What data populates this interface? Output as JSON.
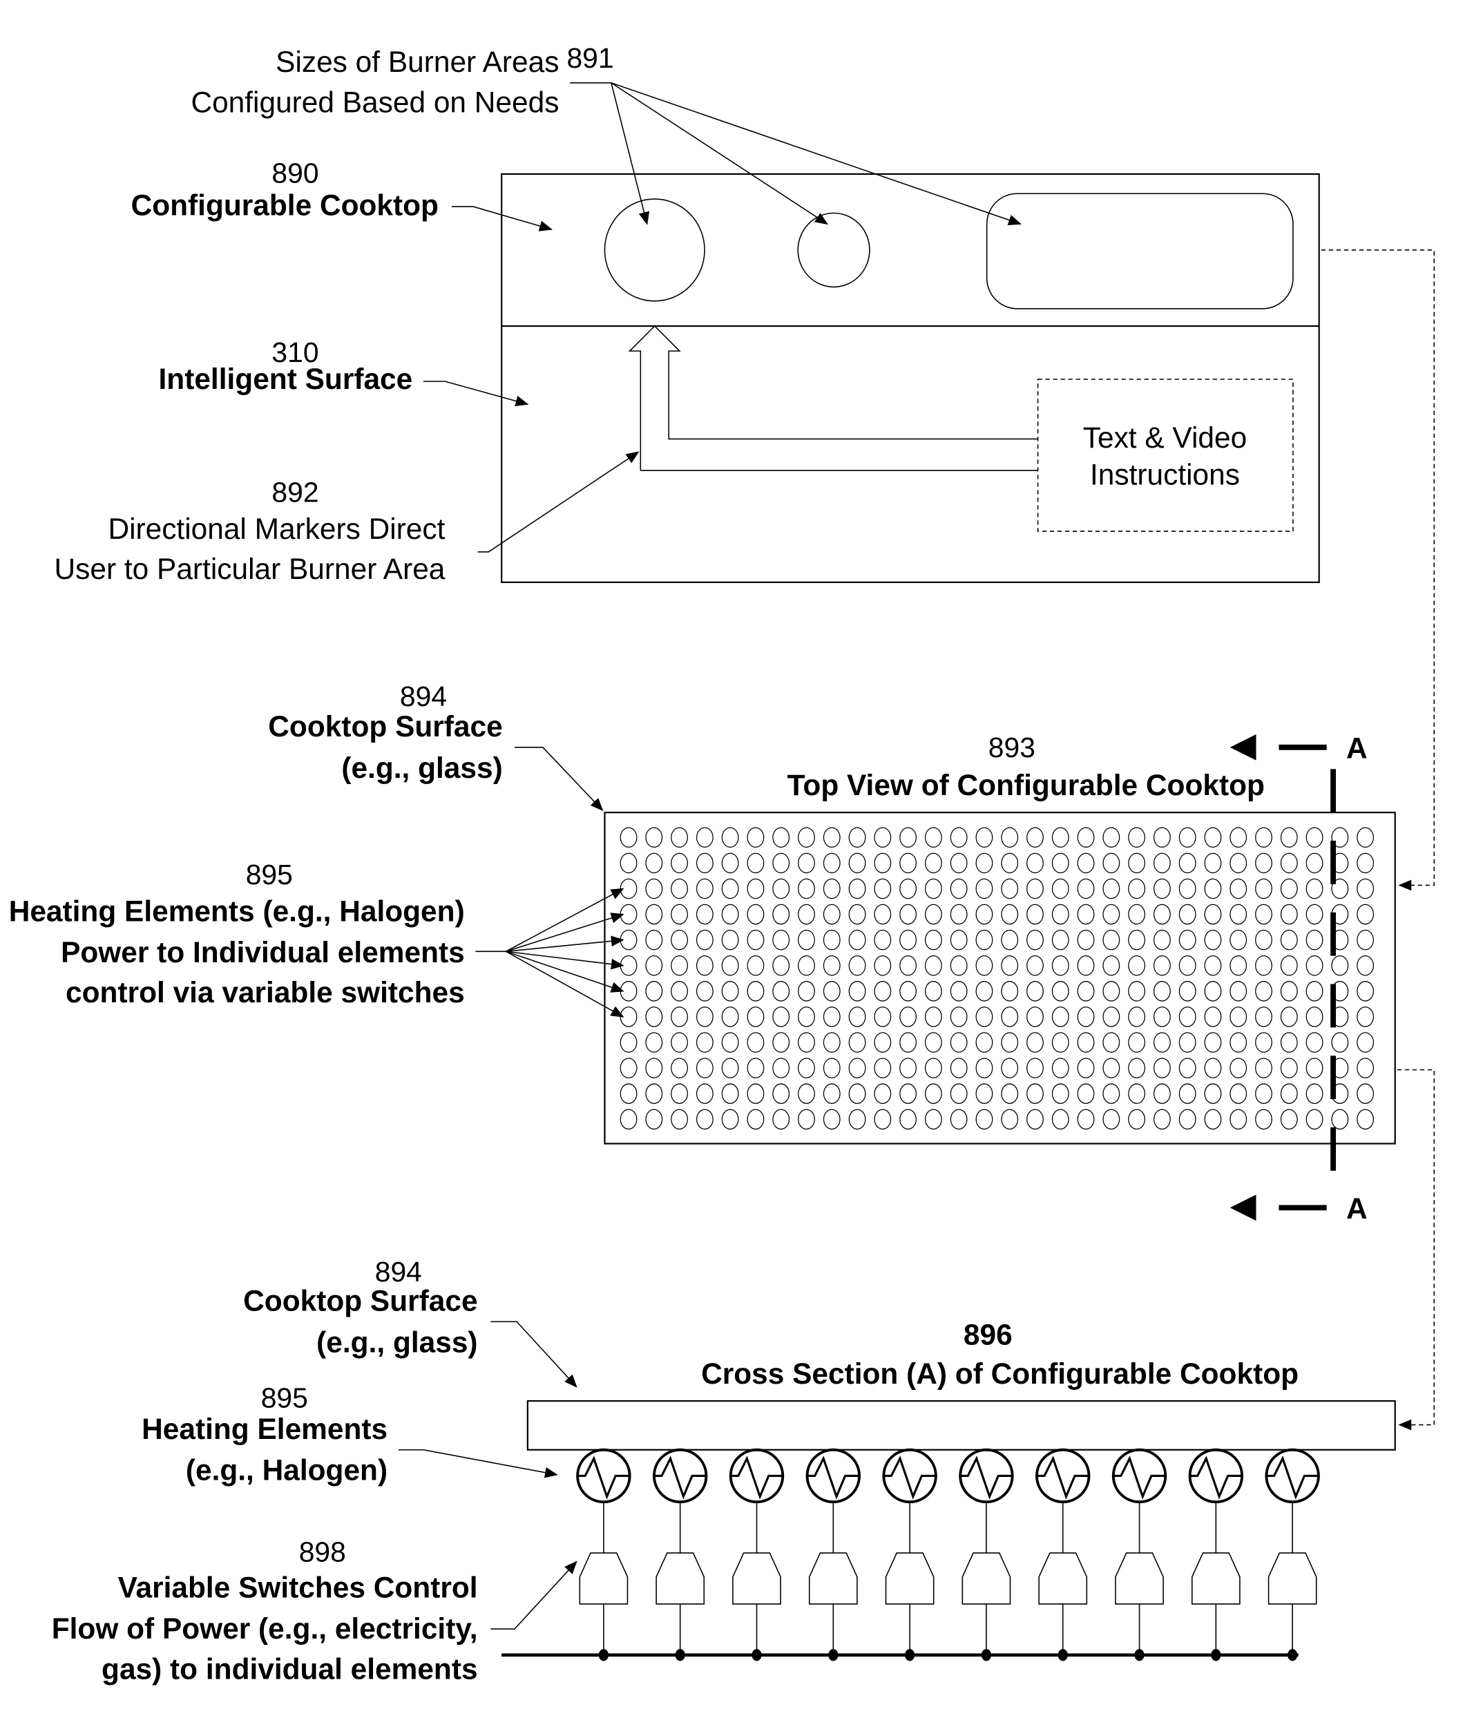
{
  "figure": {
    "top_panel": {
      "ref_891": "891",
      "label_891_line1": "Sizes of Burner Areas",
      "label_891_line2": "Configured Based on Needs",
      "ref_890": "890",
      "label_890": "Configurable Cooktop",
      "ref_310": "310",
      "label_310": "Intelligent Surface",
      "ref_892": "892",
      "label_892_line1": "Directional Markers Direct",
      "label_892_line2": "User to Particular Burner Area",
      "instructions_line1": "Text & Video",
      "instructions_line2": "Instructions"
    },
    "top_view": {
      "ref_894": "894",
      "label_894_line1": "Cooktop Surface",
      "label_894_line2": "(e.g., glass)",
      "ref_893": "893",
      "title": "Top View of Configurable Cooktop",
      "ref_895": "895",
      "label_895_line1": "Heating Elements (e.g., Halogen)",
      "label_895_line2": "Power to Individual elements",
      "label_895_line3": "control via variable switches",
      "section_marker": "A",
      "grid_columns": 30,
      "grid_rows": 12,
      "pointed_rows": [
        3,
        4,
        5,
        6,
        7,
        8
      ]
    },
    "cross_section": {
      "ref_894": "894",
      "label_894_line1": "Cooktop Surface",
      "label_894_line2": "(e.g., glass)",
      "ref_896": "896",
      "title": "Cross Section (A) of Configurable Cooktop",
      "ref_895": "895",
      "label_895_line1": "Heating Elements",
      "label_895_line2": "(e.g., Halogen)",
      "ref_898": "898",
      "label_898_line1": "Variable Switches Control",
      "label_898_line2": "Flow of Power (e.g., electricity,",
      "label_898_line3": "gas) to individual elements",
      "element_count": 10
    }
  }
}
